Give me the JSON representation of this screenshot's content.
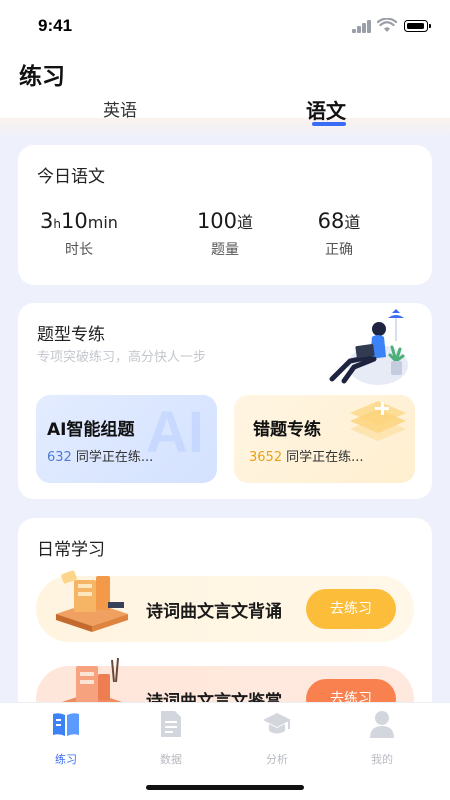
{
  "status_bar": {
    "time": "9:41"
  },
  "header": {
    "title": "练习",
    "tabs": [
      {
        "label": "英语",
        "active": false
      },
      {
        "label": "语文",
        "active": true
      }
    ]
  },
  "today_card": {
    "title": "今日语文",
    "stats": [
      {
        "parts": [
          "3",
          "h",
          "10",
          "min"
        ],
        "label": "时长"
      },
      {
        "value": "100",
        "unit": "道",
        "label": "题量"
      },
      {
        "value": "68",
        "unit": "道",
        "label": "正确"
      }
    ]
  },
  "topic_card": {
    "title": "题型专练",
    "subtitle": "专项突破练习，高分快人一步",
    "ai_card": {
      "title": "AI智能组题",
      "count": "632",
      "suffix": "同学正在练...",
      "watermark": "AI"
    },
    "wrong_card": {
      "title": "错题专练",
      "count": "3652",
      "suffix": "同学正在练..."
    }
  },
  "daily_card": {
    "title": "日常学习",
    "items": [
      {
        "title": "诗词曲文言文背诵",
        "button": "去练习"
      },
      {
        "title": "诗词曲文言文鉴赏",
        "button": "去练习"
      }
    ]
  },
  "tab_bar": {
    "items": [
      {
        "label": "练习",
        "icon": "book-icon",
        "active": true
      },
      {
        "label": "数据",
        "icon": "document-icon",
        "active": false
      },
      {
        "label": "分析",
        "icon": "graduation-cap-icon",
        "active": false
      },
      {
        "label": "我的",
        "icon": "person-icon",
        "active": false
      }
    ]
  },
  "colors": {
    "accent": "#3b6cf6",
    "orange": "#fbbd3a",
    "coral": "#f9804f"
  }
}
